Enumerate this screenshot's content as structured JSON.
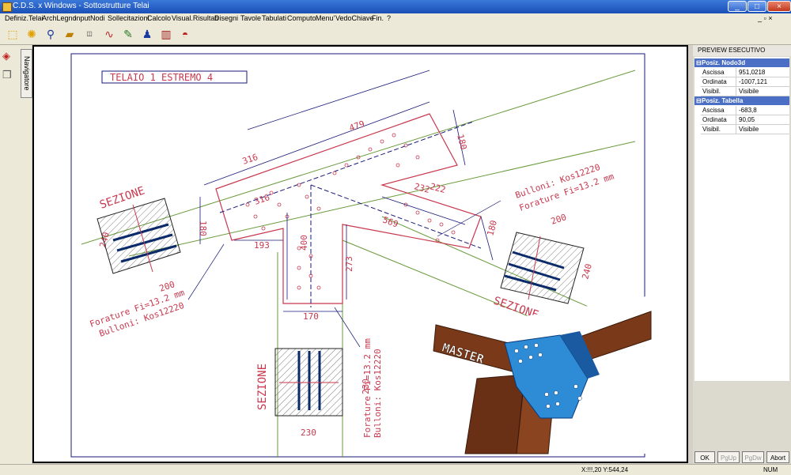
{
  "window": {
    "title": "C.D.S. x Windows - Sottostrutture Telai",
    "min": "_",
    "max": "□",
    "close": "×",
    "mdi_controls": "_ ▫ ×"
  },
  "menu": [
    "Definiz.Telai",
    "ArchLegno",
    "InputNodi",
    "Sollecitazioni",
    "Calcolo",
    "Visual.Risultati",
    "Disegni",
    "Tavole",
    "Tabulati",
    "Computo",
    "Menu'",
    "VedoChiave",
    "Fin.",
    "?"
  ],
  "navigator": {
    "label": "Navigatore"
  },
  "panel": {
    "title": "PREVIEW ESECUTIVO",
    "group1": {
      "name": "Posiz. Nodo3d",
      "rows": [
        {
          "k": "Ascissa",
          "v": "951,0218"
        },
        {
          "k": "Ordinata",
          "v": "-1007,121"
        },
        {
          "k": "Visibil.",
          "v": "Visibile"
        }
      ]
    },
    "group2": {
      "name": "Posiz. Tabella",
      "rows": [
        {
          "k": "Ascissa",
          "v": "-683,8"
        },
        {
          "k": "Ordinata",
          "v": "90,05"
        },
        {
          "k": "Visibil.",
          "v": "Visibile"
        }
      ]
    },
    "buttons": {
      "ok": "OK",
      "pgup": "PgUp",
      "pgdw": "PgDw",
      "abort": "Abort"
    }
  },
  "drawing": {
    "title": "TELAIO 1 ESTREMO 4",
    "sez": "SEZIONE",
    "bolt1": "Forature Fi=13.2 mm",
    "bolt2": "Bulloni: Kos12220",
    "dims": {
      "d479": "479",
      "d316a": "316",
      "d316b": "316",
      "d180a": "180",
      "d180b": "180",
      "d180c": "180",
      "d222": "222",
      "d232": "232",
      "d569": "569",
      "d200a": "200",
      "d200b": "200",
      "d240a": "240",
      "d240b": "240",
      "d193": "193",
      "d400": "400",
      "d273": "273",
      "d170": "170",
      "d230a": "230",
      "d230b": "230"
    },
    "master": "MASTER"
  },
  "status": {
    "coords": "X:!!!,20  Y:544,24",
    "num": "NUM"
  },
  "colors": {
    "line": "#c8384e",
    "dim": "#1a1a7a",
    "grain": "#6a9a3c",
    "wood": "#7a3a1a",
    "steel": "#2e8bd6"
  }
}
